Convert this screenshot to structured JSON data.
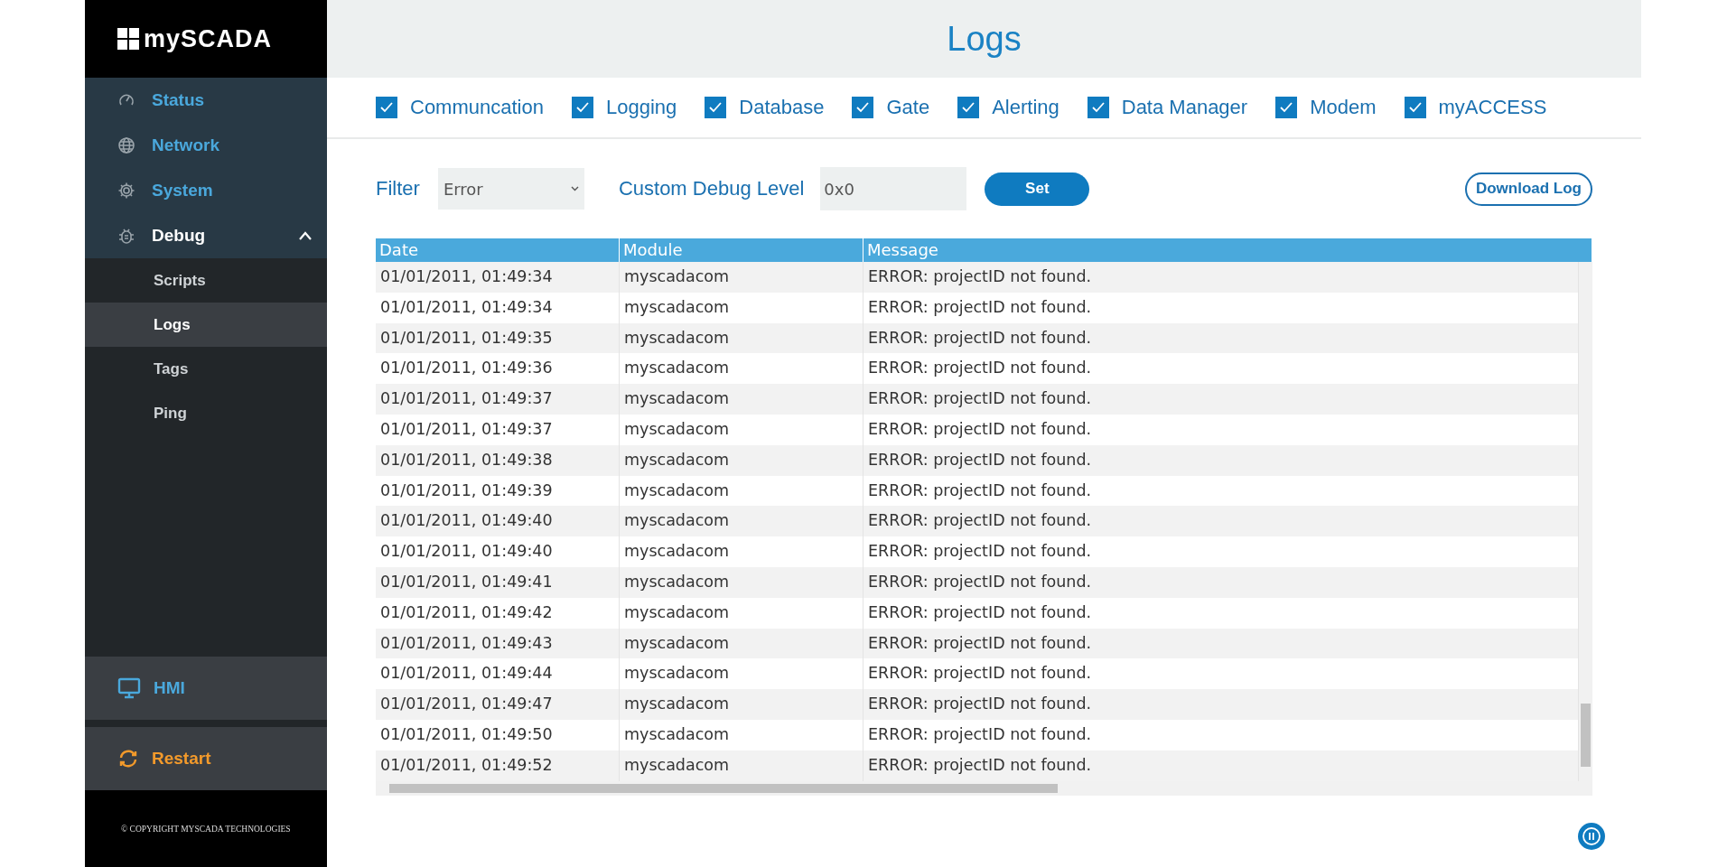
{
  "brand": "mySCADA",
  "nav": [
    {
      "label": "Status",
      "kind": "gauge",
      "selected": false
    },
    {
      "label": "Network",
      "kind": "globe",
      "selected": false
    },
    {
      "label": "System",
      "kind": "gear",
      "selected": false
    },
    {
      "label": "Debug",
      "kind": "bug",
      "selected": true,
      "expanded": true,
      "children": [
        {
          "label": "Scripts",
          "selected": false
        },
        {
          "label": "Logs",
          "selected": true
        },
        {
          "label": "Tags",
          "selected": false
        },
        {
          "label": "Ping",
          "selected": false
        }
      ]
    }
  ],
  "bottom_nav": [
    {
      "label": "HMI",
      "kind": "hmi"
    },
    {
      "label": "Restart",
      "kind": "restart"
    }
  ],
  "copyright": "© COPYRIGHT MYSCADA TECHNOLOGIES",
  "page_title": "Logs",
  "categories": [
    {
      "label": "Communcation",
      "checked": true
    },
    {
      "label": "Logging",
      "checked": true
    },
    {
      "label": "Database",
      "checked": true
    },
    {
      "label": "Gate",
      "checked": true
    },
    {
      "label": "Alerting",
      "checked": true
    },
    {
      "label": "Data Manager",
      "checked": true
    },
    {
      "label": "Modem",
      "checked": true
    },
    {
      "label": "myACCESS",
      "checked": true
    }
  ],
  "filter": {
    "label": "Filter",
    "value": "Error"
  },
  "debug_level": {
    "label": "Custom Debug Level",
    "value": "0x0"
  },
  "set_button": "Set",
  "download_button": "Download Log",
  "table": {
    "columns": [
      "Date",
      "Module",
      "Message"
    ],
    "rows": [
      [
        "01/01/2011, 01:49:34",
        "myscadacom",
        "ERROR: projectID not found."
      ],
      [
        "01/01/2011, 01:49:34",
        "myscadacom",
        "ERROR: projectID not found."
      ],
      [
        "01/01/2011, 01:49:35",
        "myscadacom",
        "ERROR: projectID not found."
      ],
      [
        "01/01/2011, 01:49:36",
        "myscadacom",
        "ERROR: projectID not found."
      ],
      [
        "01/01/2011, 01:49:37",
        "myscadacom",
        "ERROR: projectID not found."
      ],
      [
        "01/01/2011, 01:49:37",
        "myscadacom",
        "ERROR: projectID not found."
      ],
      [
        "01/01/2011, 01:49:38",
        "myscadacom",
        "ERROR: projectID not found."
      ],
      [
        "01/01/2011, 01:49:39",
        "myscadacom",
        "ERROR: projectID not found."
      ],
      [
        "01/01/2011, 01:49:40",
        "myscadacom",
        "ERROR: projectID not found."
      ],
      [
        "01/01/2011, 01:49:40",
        "myscadacom",
        "ERROR: projectID not found."
      ],
      [
        "01/01/2011, 01:49:41",
        "myscadacom",
        "ERROR: projectID not found."
      ],
      [
        "01/01/2011, 01:49:42",
        "myscadacom",
        "ERROR: projectID not found."
      ],
      [
        "01/01/2011, 01:49:43",
        "myscadacom",
        "ERROR: projectID not found."
      ],
      [
        "01/01/2011, 01:49:44",
        "myscadacom",
        "ERROR: projectID not found."
      ],
      [
        "01/01/2011, 01:49:47",
        "myscadacom",
        "ERROR: projectID not found."
      ],
      [
        "01/01/2011, 01:49:50",
        "myscadacom",
        "ERROR: projectID not found."
      ],
      [
        "01/01/2011, 01:49:52",
        "myscadacom",
        "ERROR: projectID not found."
      ]
    ]
  }
}
